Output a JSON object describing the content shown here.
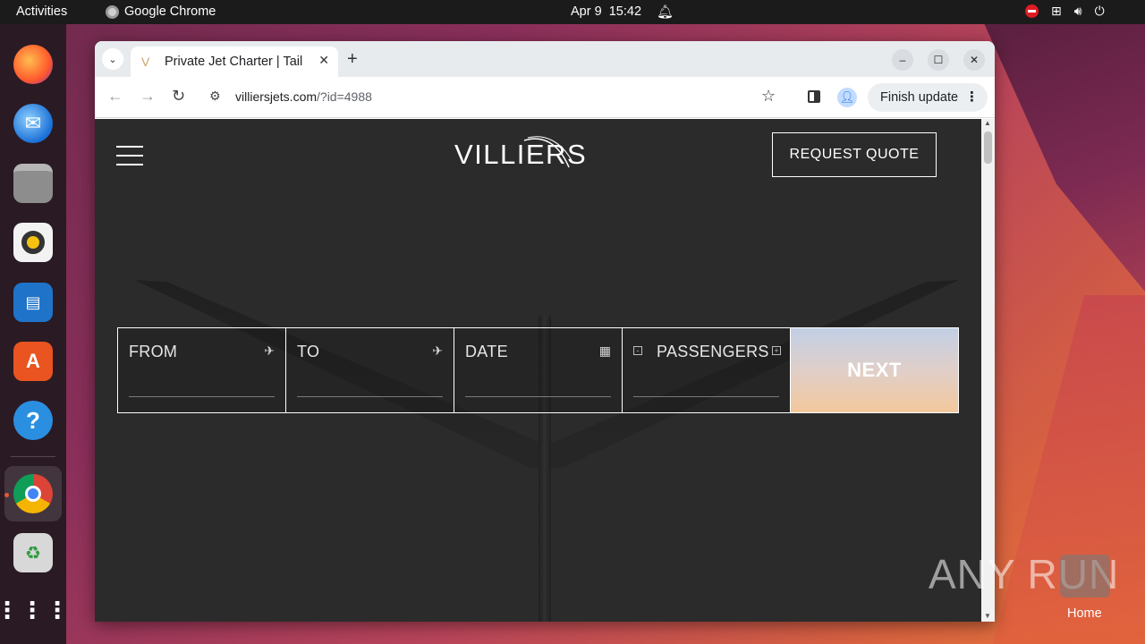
{
  "topbar": {
    "activities": "Activities",
    "app_name": "Google Chrome",
    "date": "Apr 9",
    "time": "15:42"
  },
  "dock": {
    "items": [
      "firefox-icon",
      "thunderbird-icon",
      "files-icon",
      "rhythmbox-icon",
      "libreoffice-impress-icon",
      "app-center-icon",
      "help-icon",
      "chrome-icon",
      "trash-icon",
      "show-apps-icon"
    ]
  },
  "browser": {
    "tab_title": "Private Jet Charter | Tail",
    "tab_favicon": "V",
    "url_main": "villiersjets.com",
    "url_rest": "/?id=4988",
    "finish_update": "Finish update"
  },
  "page": {
    "logo": "VILLIERS",
    "request_quote": "REQUEST QUOTE",
    "form": {
      "from": "FROM",
      "to": "TO",
      "date": "DATE",
      "passengers": "PASSENGERS",
      "next": "NEXT"
    }
  },
  "desktop": {
    "watermark": "ANY RUN",
    "home_label": "Home"
  },
  "colors": {
    "page_bg": "#2b2b2b",
    "next_gradient_top": "#c2cfe6",
    "next_gradient_bottom": "#f3c89c"
  }
}
